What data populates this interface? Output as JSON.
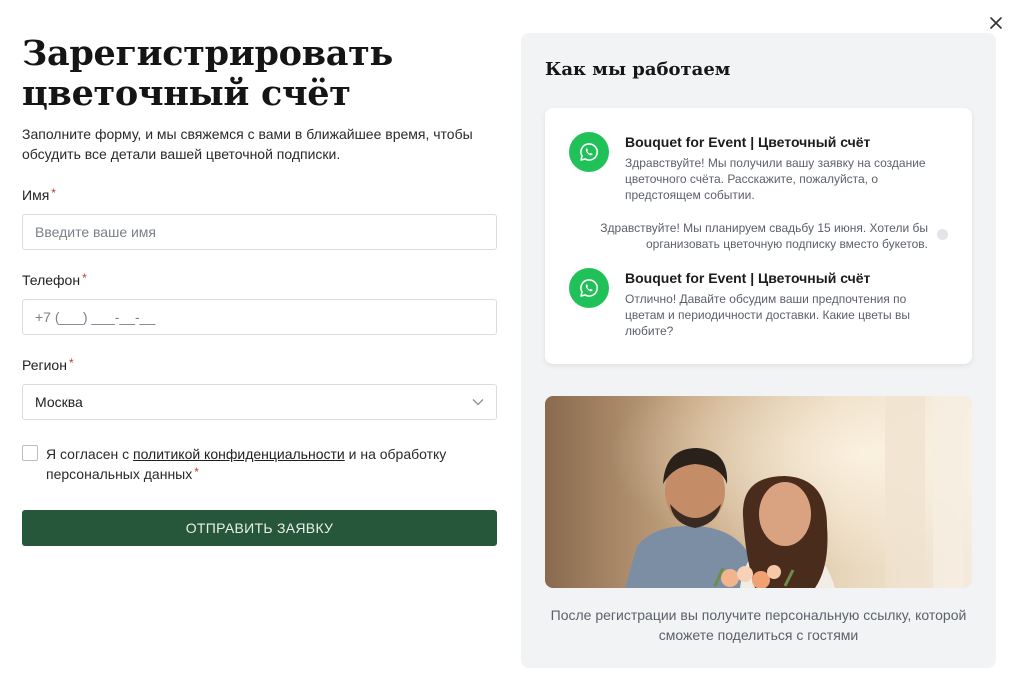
{
  "dialog": {
    "title_line1": "Зарегистрировать",
    "title_line2": "цветочный счёт",
    "subtitle": "Заполните форму, и мы свяжемся с вами в ближайшее время, чтобы обсудить все детали вашей цветочной подписки.",
    "close_icon": "close-icon"
  },
  "form": {
    "name": {
      "label": "Имя",
      "required_mark": "*",
      "placeholder": "Введите ваше имя",
      "value": ""
    },
    "phone": {
      "label": "Телефон",
      "required_mark": "*",
      "placeholder": "+7 (___) ___-__-__",
      "value": ""
    },
    "region": {
      "label": "Регион",
      "required_mark": "*",
      "value": "Москва",
      "chevron_icon": "chevron-down-icon"
    },
    "consent": {
      "checked": false,
      "text_before": "Я согласен с ",
      "link_text": "политикой конфиденциальности",
      "text_after": " и на обработку персональных данных",
      "required_mark": "*"
    },
    "submit_label": "ОТПРАВИТЬ ЗАЯВКУ"
  },
  "how_it_works": {
    "title": "Как мы работаем",
    "messages": [
      {
        "sender": "Bouquet for Event | Цветочный счёт",
        "text": "Здравствуйте! Мы получили вашу заявку на создание цветочного счёта. Расскажите, пожалуйста, о предстоящем событии.",
        "icon": "whatsapp-icon"
      },
      {
        "user_text": "Здравствуйте! Мы планируем свадьбу 15 июня. Хотели бы организовать цветочную подписку вместо букетов."
      },
      {
        "sender": "Bouquet for Event | Цветочный счёт",
        "text": "Отлично! Давайте обсудим ваши предпочтения по цветам и периодичности доставки. Какие цветы вы любите?",
        "icon": "whatsapp-icon"
      }
    ],
    "footer_note": "После регистрации вы получите персональную ссылку, которой сможете поделиться с гостями"
  },
  "colors": {
    "primary_button": "#27573a",
    "whatsapp": "#21c15a",
    "panel_bg": "#f2f3f5",
    "required": "#c0392b"
  }
}
